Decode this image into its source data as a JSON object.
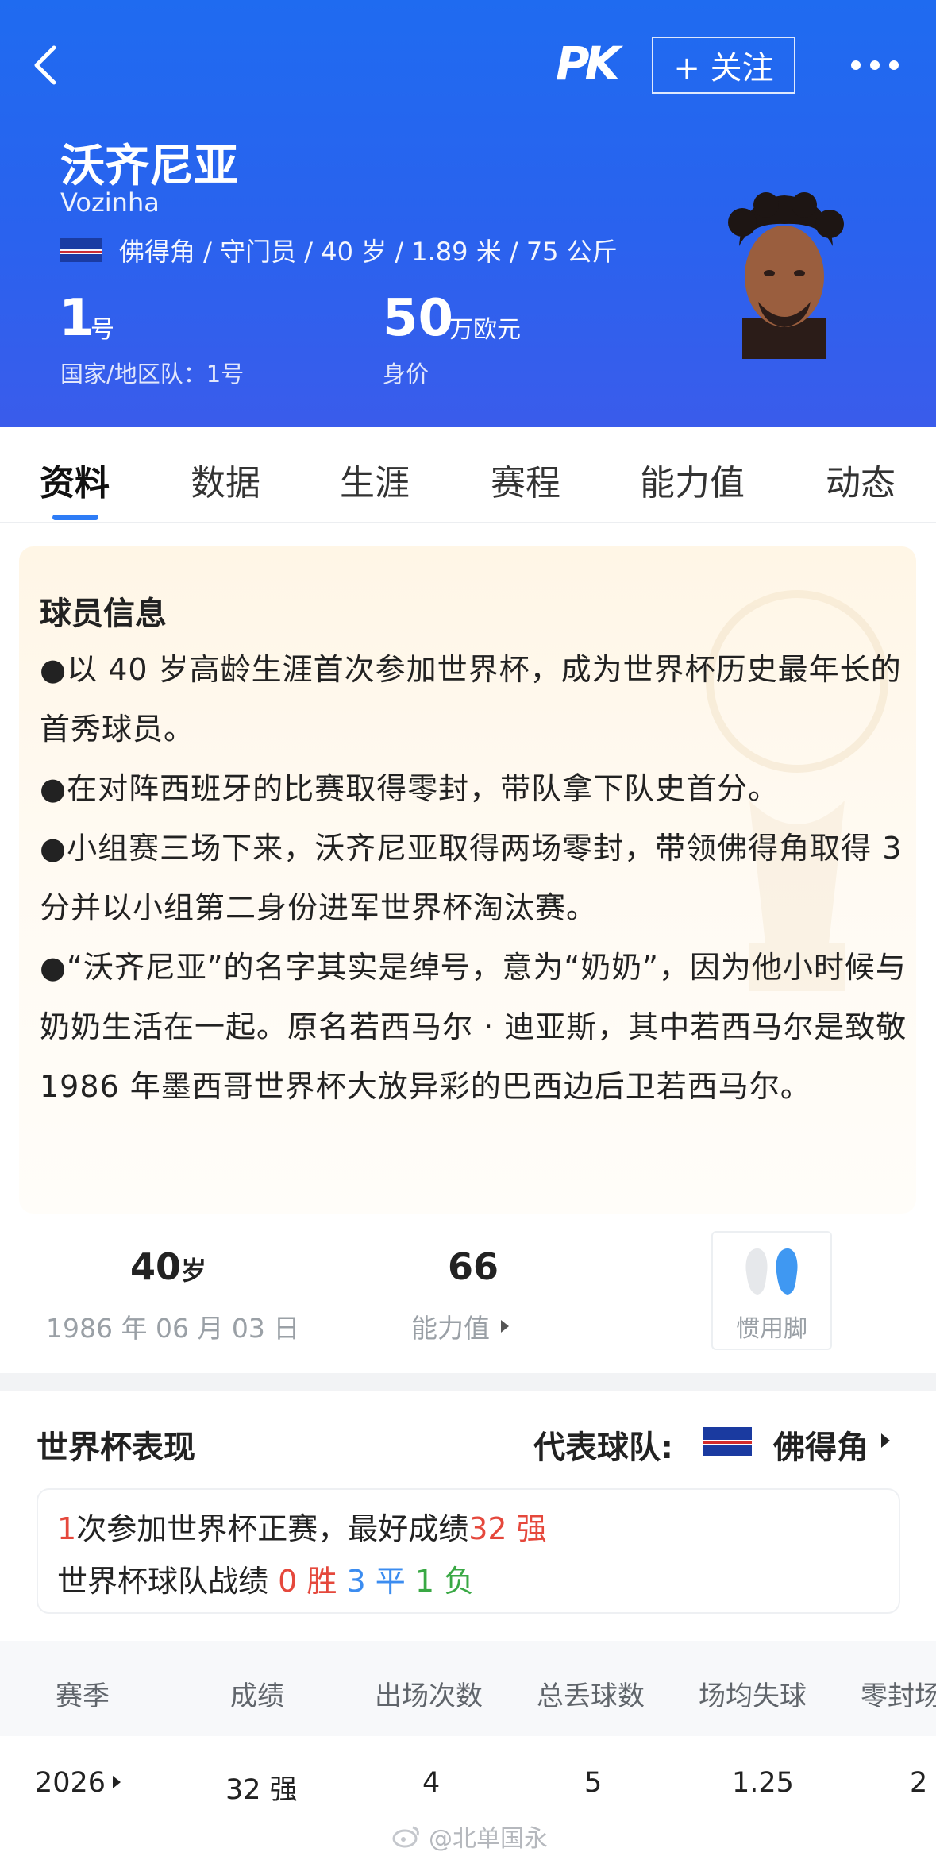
{
  "header": {
    "logo": "PK",
    "follow_label": "+ 关注",
    "player_name": "沃齐尼亚",
    "player_en": "Vozinha",
    "meta": "佛得角 / 守门员 / 40 岁 / 1.89 米 / 75 公斤",
    "number_value": "1",
    "number_unit": "号",
    "number_label": "国家/地区队：1号",
    "value_value": "50",
    "value_unit": "万欧元",
    "value_label": "身价"
  },
  "tabs": [
    "资料",
    "数据",
    "生涯",
    "赛程",
    "能力值",
    "动态"
  ],
  "info": {
    "title": "球员信息",
    "bullets": [
      "●以 40 岁高龄生涯首次参加世界杯，成为世界杯历史最年长的首秀球员。",
      "●在对阵西班牙的比赛取得零封，带队拿下队史首分。",
      "●小组赛三场下来，沃齐尼亚取得两场零封，带领佛得角取得 3 分并以小组第二身份进军世界杯淘汰赛。",
      "●“沃齐尼亚”的名字其实是绰号，意为“奶奶”，因为他小时候与奶奶生活在一起。原名若西马尔 · 迪亚斯，其中若西马尔是致敬1986 年墨西哥世界杯大放异彩的巴西边后卫若西马尔。"
    ]
  },
  "stats": {
    "age_value": "40",
    "age_suffix": "岁",
    "birthdate": "1986 年 06 月 03 日",
    "ability_value": "66",
    "ability_label": "能力值",
    "foot_label": "惯用脚"
  },
  "worldcup": {
    "title": "世界杯表现",
    "team_label": "代表球队:",
    "team_name": "佛得角",
    "summary1_count": "1",
    "summary1_text": "次参加世界杯正赛，最好成绩",
    "summary1_best": "32 强",
    "summary2_text": "世界杯球队战绩",
    "wins": "0 胜",
    "draws": "3 平",
    "losses": "1 负",
    "columns": [
      "赛季",
      "成绩",
      "出场次数",
      "总丢球数",
      "场均失球",
      "零封场"
    ],
    "row": [
      "2026",
      "32 强",
      "4",
      "5",
      "1.25",
      "2"
    ]
  },
  "watermark": "@北单国永"
}
